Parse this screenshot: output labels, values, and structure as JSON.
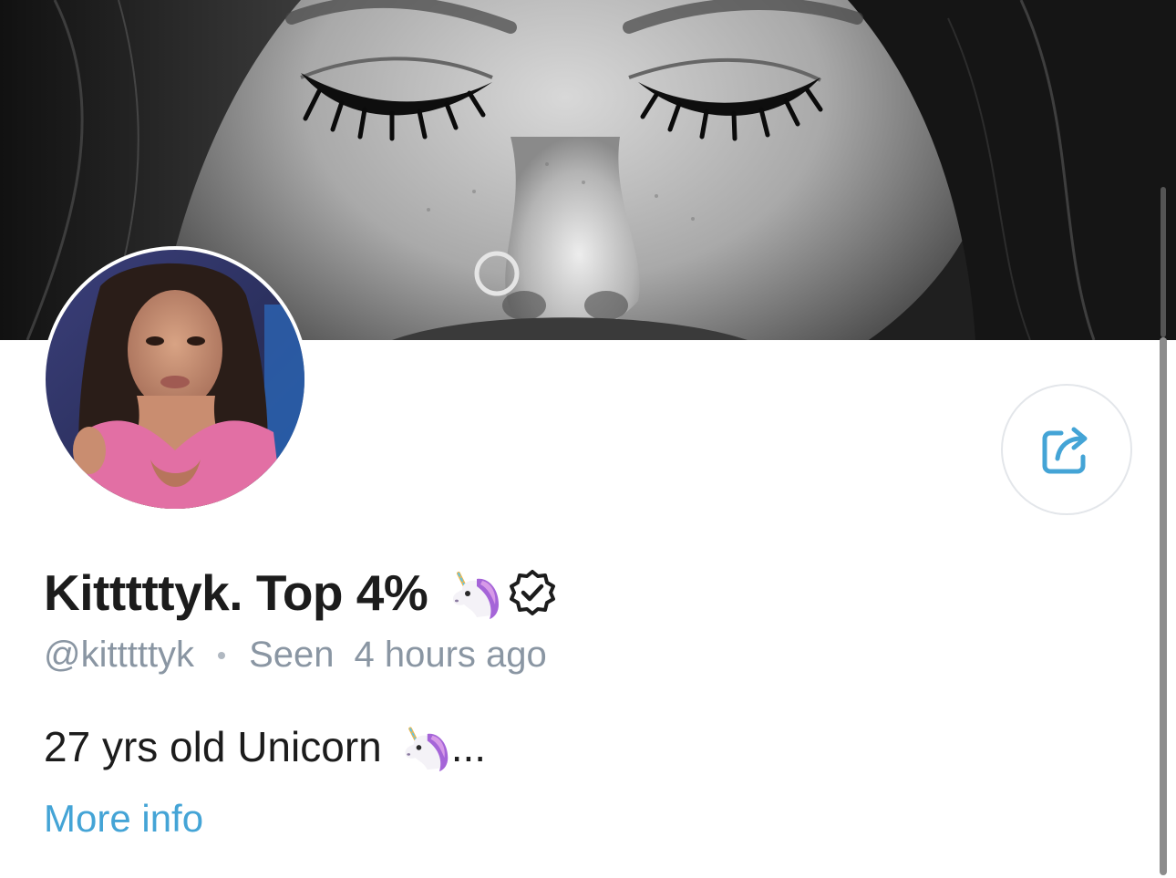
{
  "profile": {
    "display_name": "Kitttttyk. Top 4%",
    "handle": "@kitttttyk",
    "seen_label": "Seen",
    "seen_time": "4 hours ago",
    "bio": "27 yrs old Unicorn",
    "bio_ellipsis": "...",
    "more_info_label": "More info"
  },
  "icons": {
    "name_emoji": "unicorn-icon",
    "verified": "verified-badge-icon",
    "share": "share-icon",
    "bio_emoji": "unicorn-icon"
  },
  "colors": {
    "link": "#44a4d6",
    "muted": "#8a96a3",
    "text": "#1c1c1c",
    "share_icon": "#44a4d6"
  }
}
